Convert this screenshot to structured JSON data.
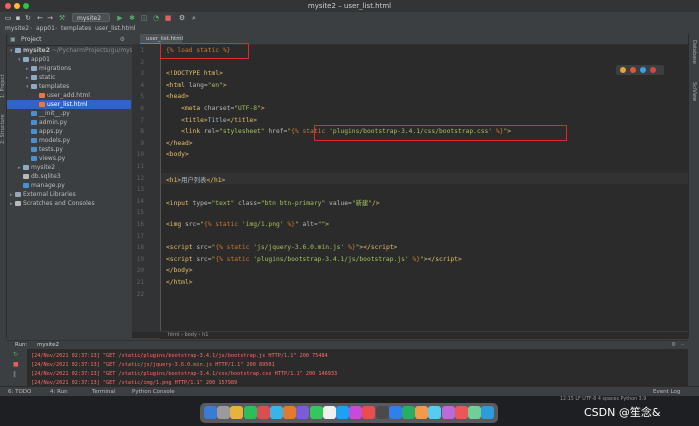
{
  "window": {
    "title": "mysite2 – user_list.html"
  },
  "toolbar": {
    "run_config": "mysite2"
  },
  "breadcrumb": [
    "mysite2",
    "app01",
    "templates",
    "user_list.html"
  ],
  "project_panel": {
    "title": "Project",
    "tree": [
      {
        "label": "mysite2",
        "suffix": "~/PycharmProjects/gu/mys",
        "indent": 0,
        "arrow": "▾",
        "icon": "folder",
        "bold": true
      },
      {
        "label": "app01",
        "indent": 1,
        "arrow": "▾",
        "icon": "folder"
      },
      {
        "label": "migrations",
        "indent": 2,
        "arrow": "▸",
        "icon": "folder"
      },
      {
        "label": "static",
        "indent": 2,
        "arrow": "▸",
        "icon": "folder"
      },
      {
        "label": "templates",
        "indent": 2,
        "arrow": "▾",
        "icon": "folder"
      },
      {
        "label": "user_add.html",
        "indent": 3,
        "arrow": "",
        "icon": "html"
      },
      {
        "label": "user_list.html",
        "indent": 3,
        "arrow": "",
        "icon": "html",
        "selected": true
      },
      {
        "label": "__init__.py",
        "indent": 2,
        "arrow": "",
        "icon": "py"
      },
      {
        "label": "admin.py",
        "indent": 2,
        "arrow": "",
        "icon": "py"
      },
      {
        "label": "apps.py",
        "indent": 2,
        "arrow": "",
        "icon": "py"
      },
      {
        "label": "models.py",
        "indent": 2,
        "arrow": "",
        "icon": "py"
      },
      {
        "label": "tests.py",
        "indent": 2,
        "arrow": "",
        "icon": "py"
      },
      {
        "label": "views.py",
        "indent": 2,
        "arrow": "",
        "icon": "py"
      },
      {
        "label": "mysite2",
        "indent": 1,
        "arrow": "▸",
        "icon": "folder"
      },
      {
        "label": "db.sqlite3",
        "indent": 1,
        "arrow": "",
        "icon": "db"
      },
      {
        "label": "manage.py",
        "indent": 1,
        "arrow": "",
        "icon": "py"
      },
      {
        "label": "External Libraries",
        "indent": 0,
        "arrow": "▸",
        "icon": "lib"
      },
      {
        "label": "Scratches and Consoles",
        "indent": 0,
        "arrow": "▸",
        "icon": "scratch"
      }
    ]
  },
  "editor": {
    "tab": "user_list.html",
    "lines": [
      {
        "n": "1",
        "html": "<span class='tpl'>{% load static %}</span>"
      },
      {
        "n": "2",
        "html": ""
      },
      {
        "n": "3",
        "html": "<span class='tag'>&lt;!DOCTYPE html&gt;</span>"
      },
      {
        "n": "4",
        "html": "<span class='tag'>&lt;html </span><span class='attr'>lang=</span><span class='str'>\"en\"</span><span class='tag'>&gt;</span>"
      },
      {
        "n": "5",
        "html": "<span class='tag'>&lt;head&gt;</span>"
      },
      {
        "n": "6",
        "html": "    <span class='tag'>&lt;meta </span><span class='attr'>charset=</span><span class='str'>\"UTF-8\"</span><span class='tag'>&gt;</span>"
      },
      {
        "n": "7",
        "html": "    <span class='tag'>&lt;title&gt;</span>Title<span class='tag'>&lt;/title&gt;</span>"
      },
      {
        "n": "8",
        "html": "    <span class='tag'>&lt;link </span><span class='attr'>rel=</span><span class='str'>\"stylesheet\"</span><span class='attr'> href=</span><span class='str'>\"</span><span class='tpl'>{% static </span><span class='str'>'plugins/bootstrap-3.4.1/css/bootstrap.css'</span><span class='tpl'> %}</span><span class='str'>\"</span><span class='tag'>&gt;</span>"
      },
      {
        "n": "9",
        "html": "<span class='tag'>&lt;/head&gt;</span>"
      },
      {
        "n": "10",
        "html": "<span class='tag'>&lt;body&gt;</span>"
      },
      {
        "n": "11",
        "html": ""
      },
      {
        "n": "12",
        "html": "<span class='tag'>&lt;h1&gt;</span>用户列表<span class='tag'>&lt;/h1&gt;</span>"
      },
      {
        "n": "13",
        "html": ""
      },
      {
        "n": "14",
        "html": "<span class='tag'>&lt;input </span><span class='attr'>type=</span><span class='str'>\"text\"</span><span class='attr'> class=</span><span class='str'>\"btn btn-primary\"</span><span class='attr'> value=</span><span class='str'>\"新建\"</span><span class='tag'>/&gt;</span>"
      },
      {
        "n": "15",
        "html": ""
      },
      {
        "n": "16",
        "html": "<span class='tag'>&lt;img </span><span class='attr'>src=</span><span class='str'>\"</span><span class='tpl'>{% static </span><span class='str'>'img/1.png'</span><span class='tpl'> %}</span><span class='str'>\"</span><span class='attr'> alt=</span><span class='str'>\"\"</span><span class='tag'>&gt;</span>"
      },
      {
        "n": "17",
        "html": ""
      },
      {
        "n": "18",
        "html": "<span class='tag'>&lt;script </span><span class='attr'>src=</span><span class='str'>\"</span><span class='tpl'>{% static </span><span class='str'>'js/jquery-3.6.0.min.js'</span><span class='tpl'> %}</span><span class='str'>\"</span><span class='tag'>&gt;&lt;/script&gt;</span>"
      },
      {
        "n": "19",
        "html": "<span class='tag'>&lt;script </span><span class='attr'>src=</span><span class='str'>\"</span><span class='tpl'>{% static </span><span class='str'>'plugins/bootstrap-3.4.1/js/bootstrap.js'</span><span class='tpl'> %}</span><span class='str'>\"</span><span class='tag'>&gt;&lt;/script&gt;</span>"
      },
      {
        "n": "20",
        "html": "<span class='tag'>&lt;/body&gt;</span>"
      },
      {
        "n": "21",
        "html": "<span class='tag'>&lt;/html&gt;</span>"
      },
      {
        "n": "22",
        "html": ""
      }
    ],
    "breadcrumb": "html  ›  body  ›  h1"
  },
  "run_panel": {
    "title": "Run:",
    "config": "mysite2",
    "logs": [
      "[24/Nov/2021 02:37:13] \"GET /static/plugins/bootstrap-3.4.1/js/bootstrap.js HTTP/1.1\" 200 75484",
      "[24/Nov/2021 02:37:13] \"GET /static/js/jquery-3.6.0.min.js HTTP/1.1\" 200 89501",
      "[24/Nov/2021 02:37:13] \"GET /static/plugins/bootstrap-3.4.1/css/bootstrap.css HTTP/1.1\" 200 146933",
      "[24/Nov/2021 02:37:13] \"GET /static/img/1.png HTTP/1.1\" 200 157989"
    ]
  },
  "bottom_bar": {
    "todo": "6: TODO",
    "run": "4: Run",
    "terminal": "Terminal",
    "python_console": "Python Console",
    "event_log": "Event Log",
    "status": "12:15   LF   UTF-8   4 spaces   Python 3.9"
  },
  "side_labels": {
    "left": [
      "1: Project",
      "2: Structure"
    ],
    "right": [
      "Database",
      "SciView"
    ],
    "favorites": "Favorites"
  },
  "watermark": "CSDN @笙念&"
}
